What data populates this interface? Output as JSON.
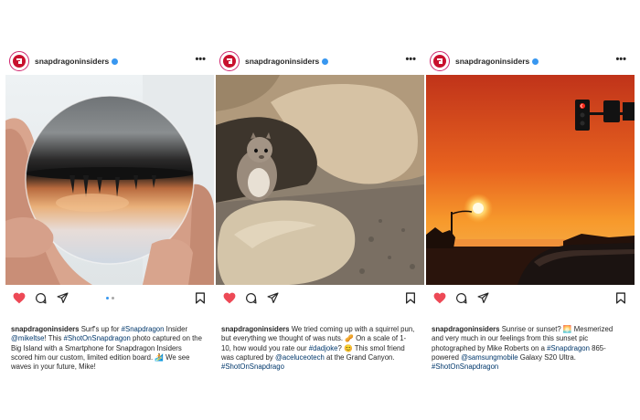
{
  "colors": {
    "accent_link": "#00376b",
    "like_red": "#ed4956",
    "verified_blue": "#3897f0",
    "brand_red": "#c8102e"
  },
  "posts": [
    {
      "username": "snapdragoninsiders",
      "more_label": "•••",
      "liked": true,
      "carousel_dots": 2,
      "caption": {
        "user": "snapdragoninsiders",
        "parts": [
          " Surf's up for ",
          "#Snapdragon",
          " Insider ",
          "@mikeltse",
          "! This ",
          "#ShotOnSnapdragon",
          " photo captured on the Big Island with a Smartphone for Snapdragon Insiders scored him our custom, limited edition board. 🏄 We see waves in your future, Mike!"
        ]
      }
    },
    {
      "username": "snapdragoninsiders",
      "more_label": "•••",
      "liked": true,
      "caption": {
        "user": "snapdragoninsiders",
        "parts": [
          " We tried coming up with a squirrel pun, but everything we thought of was nuts. 🥜 On a scale of 1-10, how would you rate our ",
          "#dadjoke",
          "? 😊 This smol friend was captured by ",
          "@aceluceotech",
          " at the Grand Canyon. ",
          "#ShotOnSnapdrago",
          ""
        ]
      }
    },
    {
      "username": "snapdragoninsiders",
      "more_label": "•••",
      "liked": true,
      "caption": {
        "user": "snapdragoninsiders",
        "parts": [
          " Sunrise or sunset? 🌅 Mesmerized and very much in our feelings from this sunset pic photographed by Mike Roberts on a ",
          "#Snapdragon",
          " 865-powered ",
          "@samsungmobile",
          " Galaxy S20 Ultra. ",
          "#ShotOnSnapdragon",
          ""
        ]
      }
    }
  ]
}
